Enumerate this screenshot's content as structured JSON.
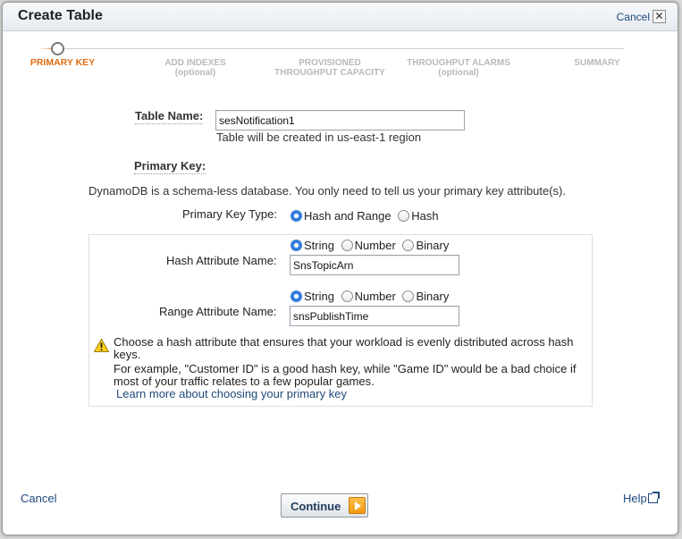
{
  "dialog": {
    "title": "Create Table",
    "cancel_top": "Cancel",
    "close_glyph": "✕"
  },
  "steps": [
    {
      "label": "PRIMARY KEY",
      "sub": "",
      "active": true
    },
    {
      "label": "ADD INDEXES",
      "sub": "(optional)",
      "active": false
    },
    {
      "label": "PROVISIONED",
      "sub": "THROUGHPUT CAPACITY",
      "active": false
    },
    {
      "label": "THROUGHPUT ALARMS",
      "sub": "(optional)",
      "active": false
    },
    {
      "label": "SUMMARY",
      "sub": "",
      "active": false
    }
  ],
  "form": {
    "table_name_label": "Table Name:",
    "table_name_value": "sesNotification1",
    "table_name_note": "Table will be created in us-east-1 region",
    "primary_key_label": "Primary Key:",
    "schema_note": "DynamoDB is a schema-less database. You only need to tell us your primary key attribute(s).",
    "pk_type_label": "Primary Key Type:",
    "pk_type_options": [
      "Hash and Range",
      "Hash"
    ],
    "pk_type_selected": "Hash and Range",
    "hash_attr_label": "Hash Attribute Name:",
    "hash_type_options": [
      "String",
      "Number",
      "Binary"
    ],
    "hash_type_selected": "String",
    "hash_attr_value": "SnsTopicArn",
    "range_attr_label": "Range Attribute Name:",
    "range_type_options": [
      "String",
      "Number",
      "Binary"
    ],
    "range_type_selected": "String",
    "range_attr_value": "snsPublishTime"
  },
  "warning": {
    "icon": "warning-triangle-icon",
    "line1": "Choose a hash attribute that ensures that your workload is evenly distributed across hash keys.",
    "line2": "For example, \"Customer ID\" is a good hash key, while \"Game ID\" would be a bad choice if most of your traffic relates to a few popular games.",
    "link": "Learn more about choosing your primary key"
  },
  "footer": {
    "cancel": "Cancel",
    "continue": "Continue",
    "help": "Help"
  },
  "colors": {
    "accent_orange": "#e06b12",
    "link_blue": "#1f4a7a",
    "radio_blue": "#2f7be0"
  }
}
